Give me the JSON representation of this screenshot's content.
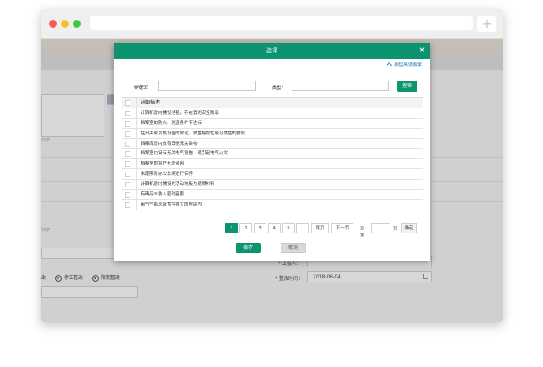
{
  "browser": {
    "new_tab_label": "+"
  },
  "background": {
    "char_hint_1": "50字",
    "char_hint_2": "50字",
    "radio_option_0": "改",
    "radio_option_1": "停工整改",
    "radio_option_2": "限期整改",
    "rectifier_label": "* 上报人：",
    "rectify_time_label": "* 整改时间：",
    "rectify_time_value": "2018-06-04"
  },
  "dialog": {
    "title": "选择",
    "close_glyph": "✕",
    "advanced_toggle": "收起高级搜索",
    "keyword_label": "关键字：",
    "keyword_value": "",
    "type_label": "类型：",
    "type_value": "",
    "search_button": "搜索",
    "table": {
      "header": "详细描述",
      "rows": [
        "计算机房内铺设地毯，存在消防安全隐患",
        "档案室的防火、防盗条件不达标",
        "在开关或发热设备的附近，放置易燃性或可燃性的物质",
        "档案库房内放有其他无关杂物",
        "档案室内设有无关电气设施，易引起电气火灾",
        "档案室的窗户无防盗网",
        "未定期对办公车辆进行保养",
        "计算机房内铺设的活动地板为易燃材料",
        "有毒品未装入密封容器",
        "氧气气瓶未设置在独立的房间内"
      ]
    },
    "pagination": {
      "pages": [
        "1",
        "2",
        "3",
        "4",
        "5",
        "..."
      ],
      "active_page": "1",
      "last_label": "尾页",
      "next_label": "下一页",
      "goto_prefix": "到第",
      "goto_value": "",
      "goto_suffix": "页",
      "confirm_label": "确定"
    },
    "save_button": "保存",
    "cancel_button": "取消"
  }
}
